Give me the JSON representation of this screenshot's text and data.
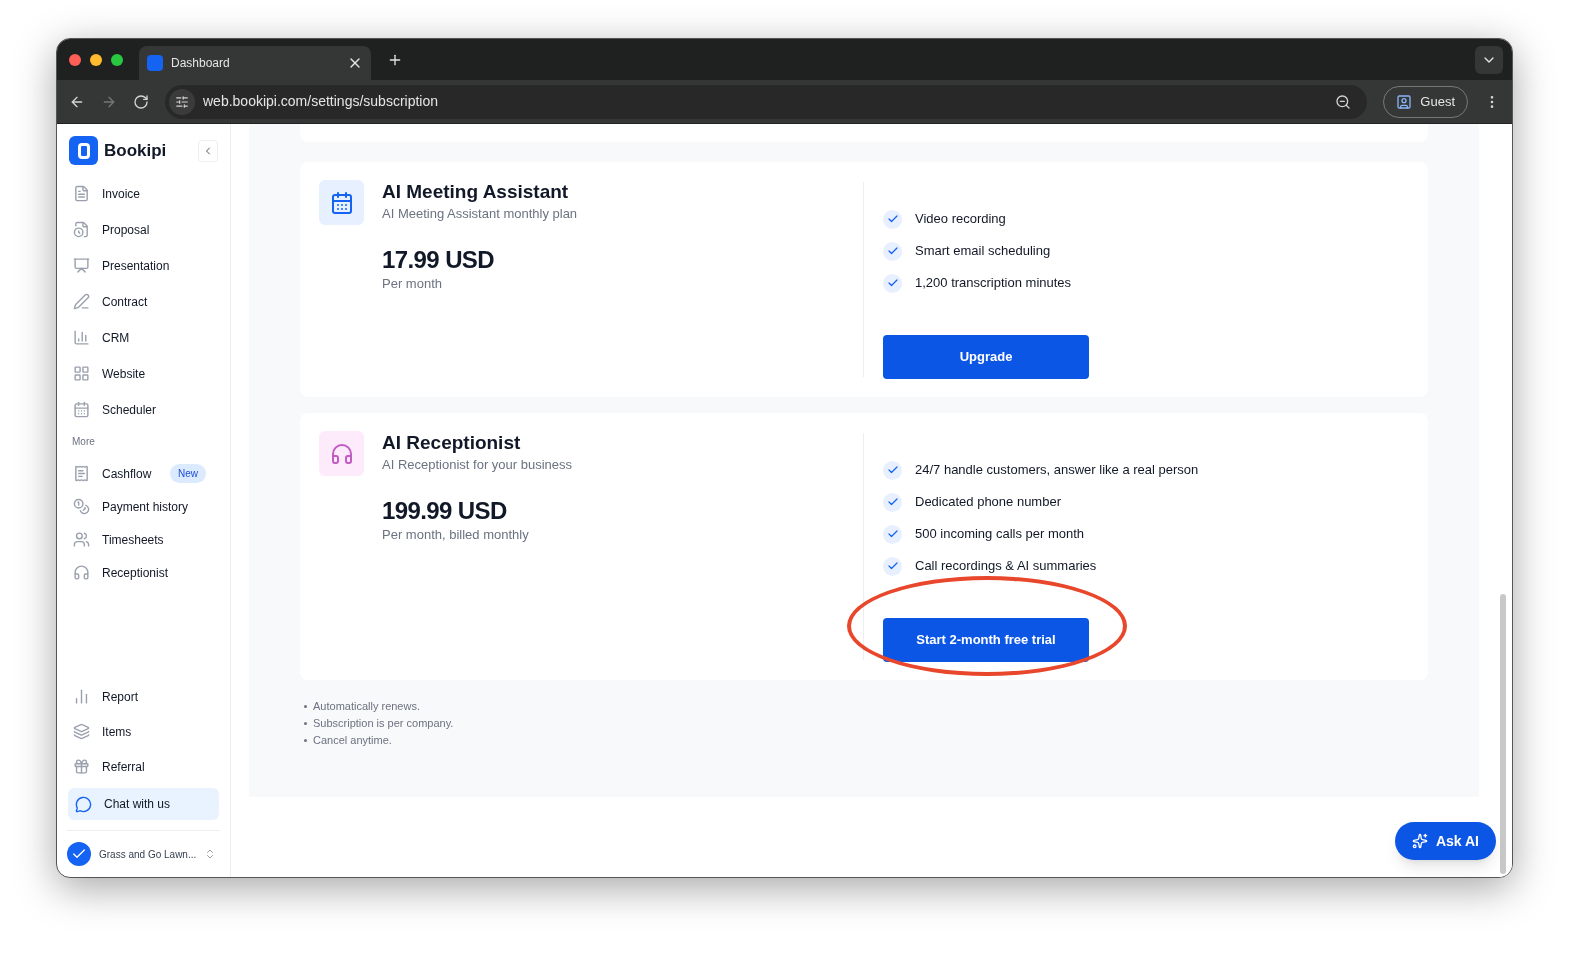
{
  "browser": {
    "tab_title": "Dashboard",
    "url": "web.bookipi.com/settings/subscription",
    "profile": "Guest"
  },
  "sidebar": {
    "brand": "Bookipi",
    "items": [
      {
        "label": "Invoice"
      },
      {
        "label": "Proposal"
      },
      {
        "label": "Presentation"
      },
      {
        "label": "Contract"
      },
      {
        "label": "CRM"
      },
      {
        "label": "Website"
      },
      {
        "label": "Scheduler"
      }
    ],
    "section": "More",
    "more_items": [
      {
        "label": "Cashflow",
        "badge": "New"
      },
      {
        "label": "Payment history"
      },
      {
        "label": "Timesheets"
      },
      {
        "label": "Receptionist"
      }
    ],
    "bottom_items": [
      {
        "label": "Report"
      },
      {
        "label": "Items"
      },
      {
        "label": "Referral"
      }
    ],
    "chat": "Chat with us",
    "company": "Grass and Go Lawn..."
  },
  "plans": [
    {
      "kind": "meeting",
      "title": "AI Meeting Assistant",
      "subtitle": "AI Meeting Assistant monthly plan",
      "price": "17.99 USD",
      "period": "Per month",
      "features": [
        "Video recording",
        "Smart email scheduling",
        "1,200 transcription minutes"
      ],
      "button": "Upgrade",
      "circled": false
    },
    {
      "kind": "receptionist",
      "title": "AI Receptionist",
      "subtitle": "AI Receptionist for your business",
      "price": "199.99 USD",
      "period": "Per month, billed monthly",
      "features": [
        "24/7 handle customers, answer like a real person",
        "Dedicated phone number",
        "500 incoming calls per month",
        "Call recordings & AI summaries"
      ],
      "button": "Start 2-month free trial",
      "circled": true
    }
  ],
  "notes": [
    "Automatically renews.",
    "Subscription is per company.",
    "Cancel anytime."
  ],
  "ask_ai": "Ask AI"
}
